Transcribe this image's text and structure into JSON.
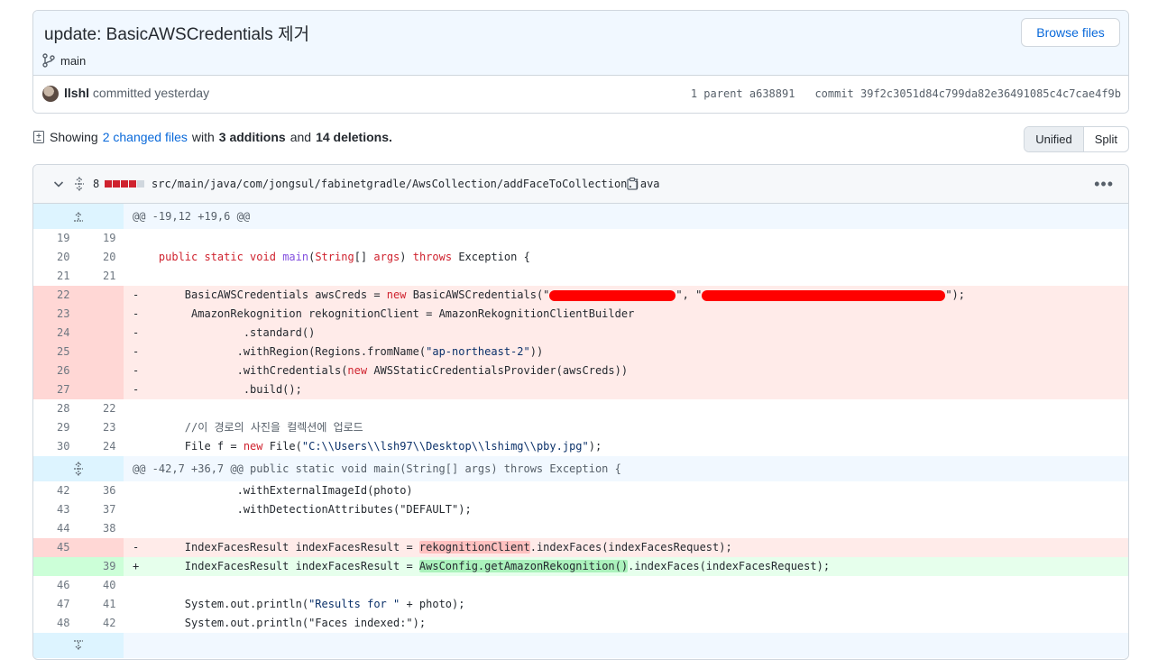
{
  "commit": {
    "title": "update: BasicAWSCredentials 제거",
    "branch": "main",
    "browse_label": "Browse files",
    "author": "llshl",
    "committed_text": "committed yesterday",
    "parent_text": "1 parent a638891",
    "commit_text": "commit 39f2c3051d84c799da82e36491085c4c7cae4f9b"
  },
  "summary": {
    "prefix": "Showing",
    "changed_files": "2 changed files",
    "with": "with",
    "additions": "3 additions",
    "and": "and",
    "deletions": "14 deletions."
  },
  "view_toggle": {
    "unified": "Unified",
    "split": "Split"
  },
  "file": {
    "change_count": "8",
    "path": "src/main/java/com/jongsul/fabinetgradle/AwsCollection/addFaceToCollection.java",
    "hunk1": "@@ -19,12 +19,6 @@",
    "hunk2": "@@ -42,7 +36,7 @@ public static void main(String[] args) throws Exception {"
  },
  "colors": {
    "deleted": "#cf222e",
    "added": "#2da44e",
    "link": "#0969da"
  },
  "lines": {
    "l1": {
      "old": "19",
      "new": "19",
      "text": ""
    },
    "l2": {
      "old": "20",
      "new": "20"
    },
    "l3": {
      "old": "21",
      "new": "21",
      "text": ""
    },
    "d1": {
      "old": "22",
      "new": "",
      "sign": "-"
    },
    "d2": {
      "old": "23",
      "new": "",
      "sign": "-",
      "text": "        AmazonRekognition rekognitionClient = AmazonRekognitionClientBuilder"
    },
    "d3": {
      "old": "24",
      "new": "",
      "sign": "-",
      "text": "                .standard()"
    },
    "d4": {
      "old": "25",
      "new": "",
      "sign": "-"
    },
    "d5": {
      "old": "26",
      "new": "",
      "sign": "-"
    },
    "d6": {
      "old": "27",
      "new": "",
      "sign": "-",
      "text": "                .build();"
    },
    "l4": {
      "old": "28",
      "new": "22",
      "text": ""
    },
    "l5": {
      "old": "29",
      "new": "23",
      "text": "        //이 경로의 사진을 컬렉션에 업로드"
    },
    "l6": {
      "old": "30",
      "new": "24"
    },
    "l7": {
      "old": "42",
      "new": "36",
      "text": "                .withExternalImageId(photo)"
    },
    "l8": {
      "old": "43",
      "new": "37",
      "text": "                .withDetectionAttributes(\"DEFAULT\");"
    },
    "l9": {
      "old": "44",
      "new": "38",
      "text": ""
    },
    "d7": {
      "old": "45",
      "new": "",
      "sign": "-"
    },
    "a1": {
      "old": "",
      "new": "39",
      "sign": "+"
    },
    "l10": {
      "old": "46",
      "new": "40",
      "text": ""
    },
    "l11": {
      "old": "47",
      "new": "41"
    },
    "l12": {
      "old": "48",
      "new": "42",
      "text": "        System.out.println(\"Faces indexed:\");"
    }
  }
}
